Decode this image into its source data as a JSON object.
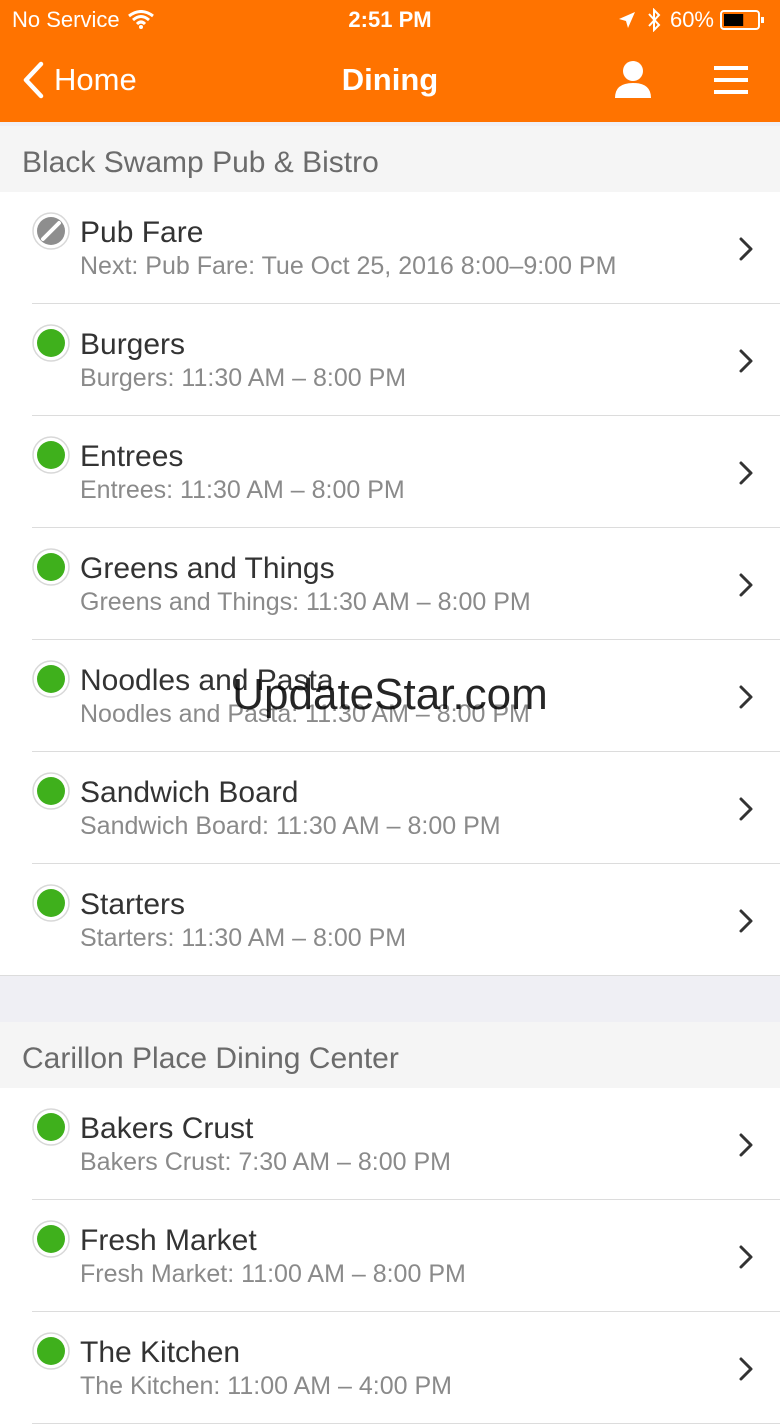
{
  "status_bar": {
    "carrier": "No Service",
    "time": "2:51 PM",
    "battery": "60%"
  },
  "nav": {
    "back_label": "Home",
    "title": "Dining"
  },
  "colors": {
    "accent": "#ff7300",
    "open": "#3fb01c",
    "closed": "#8e8e8e"
  },
  "sections": [
    {
      "title": "Black Swamp Pub & Bistro",
      "items": [
        {
          "name": "Pub Fare",
          "detail": "Next: Pub Fare: Tue Oct 25, 2016 8:00–9:00 PM",
          "status": "closed"
        },
        {
          "name": "Burgers",
          "detail": "Burgers: 11:30 AM – 8:00 PM",
          "status": "open"
        },
        {
          "name": "Entrees",
          "detail": "Entrees: 11:30 AM – 8:00 PM",
          "status": "open"
        },
        {
          "name": "Greens and Things",
          "detail": "Greens and Things: 11:30 AM – 8:00 PM",
          "status": "open"
        },
        {
          "name": "Noodles and Pasta",
          "detail": "Noodles and Pasta: 11:30 AM – 8:00 PM",
          "status": "open"
        },
        {
          "name": "Sandwich Board",
          "detail": "Sandwich Board: 11:30 AM – 8:00 PM",
          "status": "open"
        },
        {
          "name": "Starters",
          "detail": "Starters: 11:30 AM – 8:00 PM",
          "status": "open"
        }
      ]
    },
    {
      "title": "Carillon Place Dining Center",
      "items": [
        {
          "name": "Bakers Crust",
          "detail": "Bakers Crust: 7:30 AM – 8:00 PM",
          "status": "open"
        },
        {
          "name": "Fresh Market",
          "detail": "Fresh Market: 11:00 AM – 8:00 PM",
          "status": "open"
        },
        {
          "name": "The Kitchen",
          "detail": "The Kitchen: 11:00 AM – 4:00 PM",
          "status": "open"
        }
      ]
    }
  ],
  "watermark": "UpdateStar.com"
}
